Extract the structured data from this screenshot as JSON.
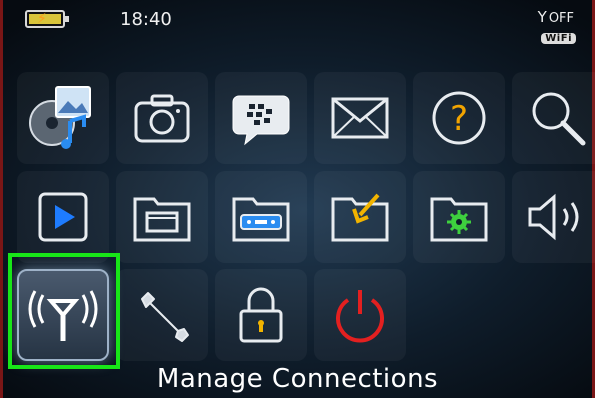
{
  "status_bar": {
    "time": "18:40",
    "radio_status": "OFF",
    "wifi_badge": "WiFi"
  },
  "selected_app_label": "Manage Connections",
  "colors": {
    "selection_highlight": "#18e618",
    "power_icon": "#e32020",
    "play_icon": "#1e7cff"
  }
}
